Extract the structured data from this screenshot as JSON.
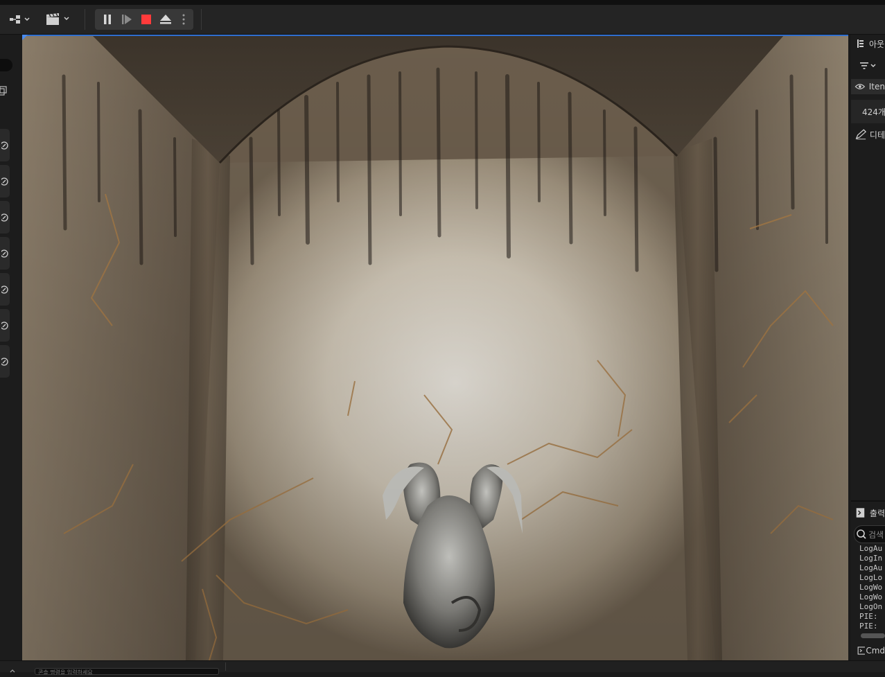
{
  "toolbar": {
    "mode_icon": "modes-icon",
    "cinematics_icon": "clapperboard-icon",
    "play_controls": [
      "pause-icon",
      "step-frame-icon",
      "stop-icon",
      "eject-icon",
      "more-options-icon"
    ],
    "stop_color": "#ff3b3b"
  },
  "left_sidebar": {
    "tab_count": 7,
    "tab_icon": "visibility-icon"
  },
  "viewport": {
    "scene": "stone niche with horned gargoyle sculpture lit by spotlight"
  },
  "outliner": {
    "title": "아웃",
    "filter_icon": "filter-icon",
    "column_item": "Iten",
    "count_text": "424개"
  },
  "details": {
    "title": "디테"
  },
  "output_log": {
    "title": "출력",
    "search_placeholder": "검색",
    "lines": [
      "LogAu",
      "LogIn",
      "LogAu",
      "LogLo",
      "LogWo",
      "LogWo",
      "LogOn",
      "PIE: ",
      "PIE: "
    ],
    "cmd_label": "Cmd"
  },
  "statusbar": {
    "console_placeholder": "콘솔 명령을 입력하세요"
  }
}
